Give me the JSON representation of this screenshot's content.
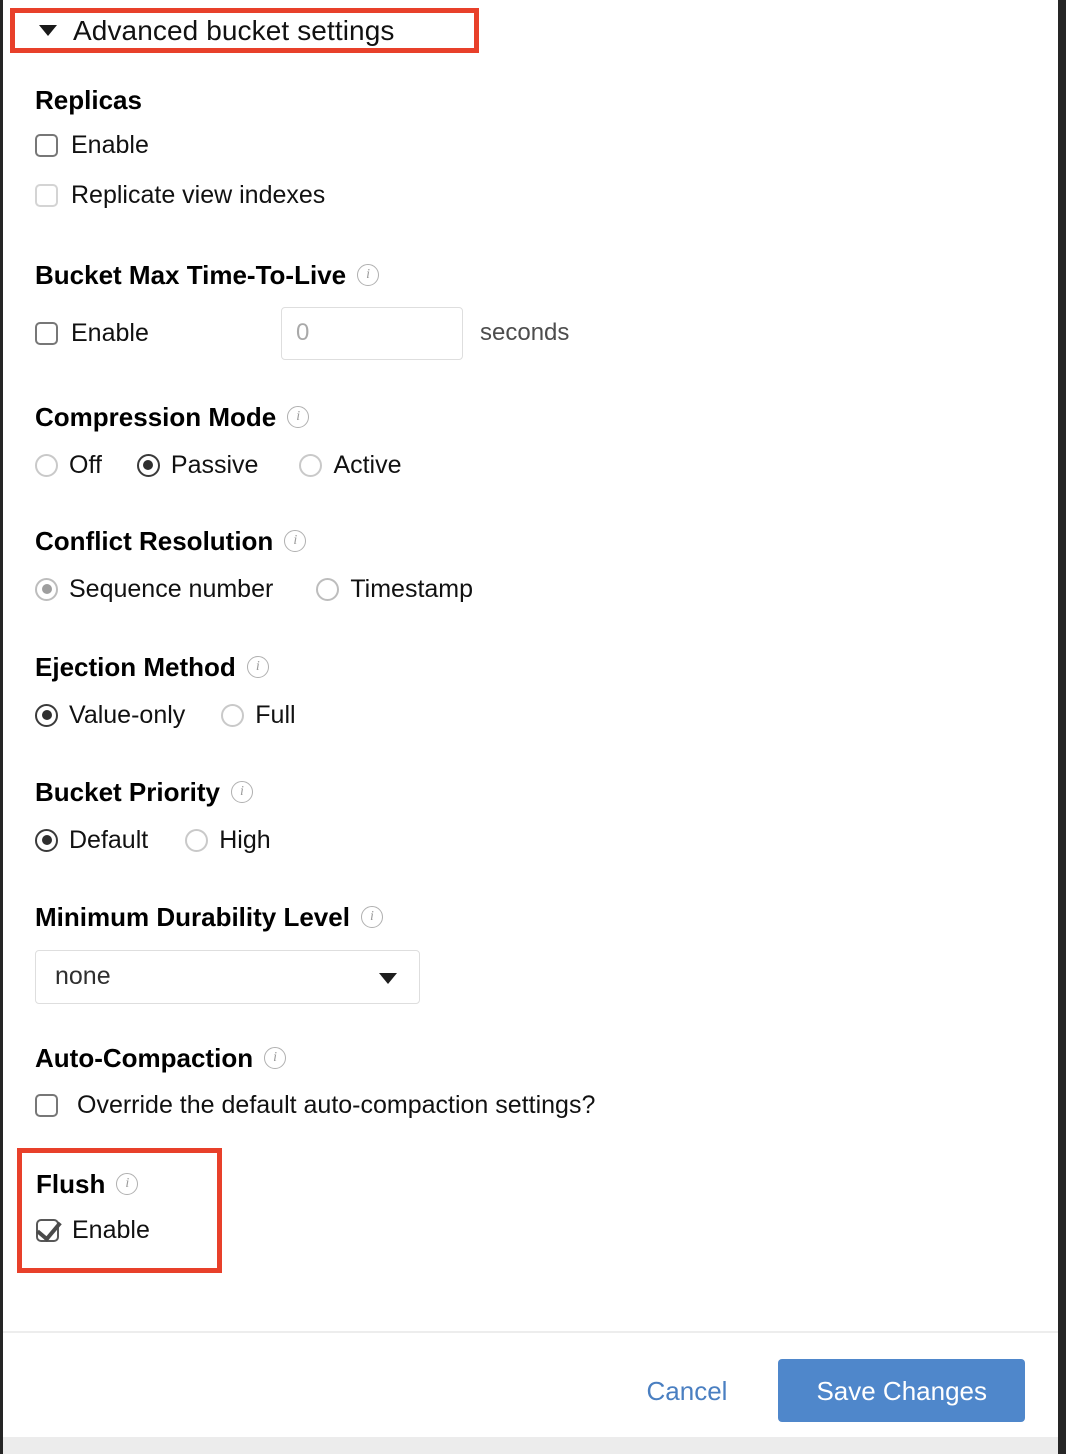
{
  "header": {
    "label": "Advanced bucket settings",
    "caret_icon": "caret-down-icon",
    "expanded": true,
    "highlight_color": "#e8402a"
  },
  "sections": {
    "replicas": {
      "title": "Replicas",
      "enable_label": "Enable",
      "enable_checked": false,
      "replicate_label": "Replicate view indexes",
      "replicate_checked": false
    },
    "ttl": {
      "title": "Bucket Max Time-To-Live",
      "info_icon": "info-icon",
      "enable_label": "Enable",
      "enable_checked": false,
      "value": "",
      "placeholder": "0",
      "units": "seconds"
    },
    "compression": {
      "title": "Compression Mode",
      "info_icon": "info-icon",
      "options": [
        "Off",
        "Passive",
        "Active"
      ],
      "selected": "Passive"
    },
    "conflict": {
      "title": "Conflict Resolution",
      "info_icon": "info-icon",
      "options": [
        "Sequence number",
        "Timestamp"
      ],
      "selected": "Sequence number",
      "disabled": true
    },
    "ejection": {
      "title": "Ejection Method",
      "info_icon": "info-icon",
      "options": [
        "Value-only",
        "Full"
      ],
      "selected": "Value-only"
    },
    "priority": {
      "title": "Bucket Priority",
      "info_icon": "info-icon",
      "options": [
        "Default",
        "High"
      ],
      "selected": "Default"
    },
    "durability": {
      "title": "Minimum Durability Level",
      "info_icon": "info-icon",
      "selected": "none",
      "caret_icon": "chevron-down-icon"
    },
    "autocompaction": {
      "title": "Auto-Compaction",
      "info_icon": "info-icon",
      "override_label": "Override the default auto-compaction settings?",
      "override_checked": false
    },
    "flush": {
      "title": "Flush",
      "info_icon": "info-icon",
      "enable_label": "Enable",
      "enable_checked": true,
      "highlight_color": "#e8402a"
    }
  },
  "footer": {
    "cancel_label": "Cancel",
    "save_label": "Save Changes",
    "save_color": "#4f87cb",
    "cancel_color": "#4a7fc1"
  }
}
